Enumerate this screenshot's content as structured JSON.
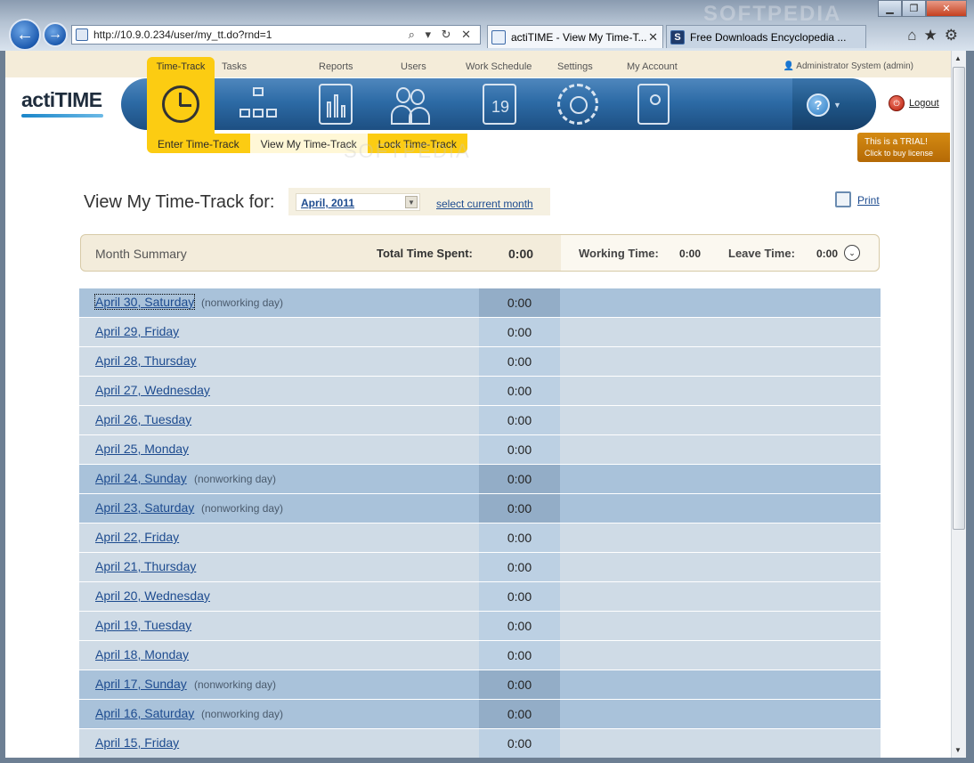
{
  "browser": {
    "url": "http://10.9.0.234/user/my_tt.do?rnd=1",
    "address_tools": "⌕ ▾ ↻ ✕",
    "tabs": [
      {
        "title": "actiTIME - View My Time-T...",
        "icon": "actitime-favicon"
      },
      {
        "title": "Free Downloads Encyclopedia ...",
        "icon": "softpedia-favicon",
        "icon_letter": "S"
      }
    ],
    "window_buttons": [
      "▁",
      "❐",
      "✕"
    ],
    "right_icons": "⌂★⚙",
    "watermark": "SOFTPEDIA"
  },
  "app": {
    "logo": "actiTIME",
    "menu": [
      "Time-Track",
      "Tasks",
      "Reports",
      "Users",
      "Work Schedule",
      "Settings",
      "My Account"
    ],
    "user": "Administrator System (admin)",
    "logout": "Logout",
    "help_icon": "?",
    "schedule_day": "19",
    "submenu": [
      "Enter Time-Track",
      "View My Time-Track",
      "Lock Time-Track"
    ],
    "submenu_active": "View My Time-Track",
    "trial": {
      "line1": "This is a TRIAL!",
      "line2": "Click to buy license"
    },
    "watermark": "SOFTPEDIA"
  },
  "main": {
    "title": "View My Time-Track for:",
    "month": "April, 2011",
    "select_current": "select current month",
    "print": "Print",
    "summary": {
      "title": "Month Summary",
      "total_label": "Total Time Spent:",
      "total_value": "0:00",
      "working_label": "Working Time:",
      "working_value": "0:00",
      "leave_label": "Leave Time:",
      "leave_value": "0:00"
    },
    "days": [
      {
        "date": "April 30, Saturday",
        "note": "(nonworking day)",
        "time": "0:00"
      },
      {
        "date": "April 29, Friday",
        "note": "",
        "time": "0:00"
      },
      {
        "date": "April 28, Thursday",
        "note": "",
        "time": "0:00"
      },
      {
        "date": "April 27, Wednesday",
        "note": "",
        "time": "0:00"
      },
      {
        "date": "April 26, Tuesday",
        "note": "",
        "time": "0:00"
      },
      {
        "date": "April 25, Monday",
        "note": "",
        "time": "0:00"
      },
      {
        "date": "April 24, Sunday",
        "note": "(nonworking day)",
        "time": "0:00"
      },
      {
        "date": "April 23, Saturday",
        "note": "(nonworking day)",
        "time": "0:00"
      },
      {
        "date": "April 22, Friday",
        "note": "",
        "time": "0:00"
      },
      {
        "date": "April 21, Thursday",
        "note": "",
        "time": "0:00"
      },
      {
        "date": "April 20, Wednesday",
        "note": "",
        "time": "0:00"
      },
      {
        "date": "April 19, Tuesday",
        "note": "",
        "time": "0:00"
      },
      {
        "date": "April 18, Monday",
        "note": "",
        "time": "0:00"
      },
      {
        "date": "April 17, Sunday",
        "note": "(nonworking day)",
        "time": "0:00"
      },
      {
        "date": "April 16, Saturday",
        "note": "(nonworking day)",
        "time": "0:00"
      },
      {
        "date": "April 15, Friday",
        "note": "",
        "time": "0:00"
      }
    ]
  }
}
